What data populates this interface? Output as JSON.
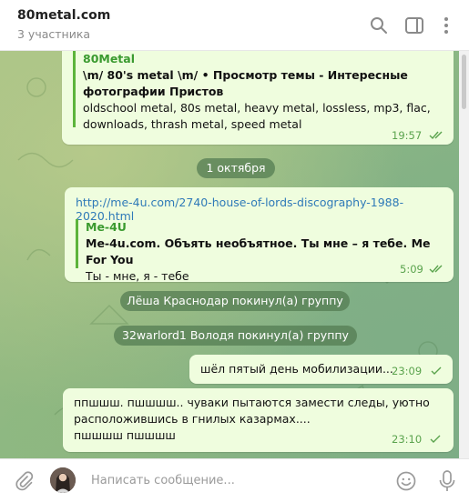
{
  "header": {
    "title": "80metal.com",
    "subtitle": "3 участника",
    "icons": [
      "search-icon",
      "sidebar-toggle-icon",
      "more-vertical-icon"
    ]
  },
  "messages": [
    {
      "type": "outgoing-preview",
      "preview": {
        "site": "80Metal",
        "title": "\\m/ 80's metal \\m/ • Просмотр темы - Интересные фотографии Пристов",
        "description": "oldschool metal, 80s metal, heavy metal, lossless, mp3, flac, downloads, thrash metal, speed metal"
      },
      "time": "19:57"
    },
    {
      "type": "date",
      "text": "1 октября"
    },
    {
      "type": "outgoing-link",
      "link": "http://me-4u.com/2740-house-of-lords-discography-1988-2020.html",
      "preview": {
        "site": "Me-4U",
        "title": "Me-4u.com. Объять необъятное. Ты мне – я тебе. Me For You",
        "description": "Ты - мне, я - тебе"
      },
      "time": "5:09"
    },
    {
      "type": "service",
      "text": "Лёша Краснодар покинул(а) группу"
    },
    {
      "type": "service",
      "text": "32warlord1 Володя покинул(а) группу"
    },
    {
      "type": "outgoing",
      "text": "шёл пятый день мобилизации...",
      "time": "23:09"
    },
    {
      "type": "outgoing",
      "lines": [
        "ппшшш. пшшшш.. чуваки пытаются замести следы, уютно",
        "расположившись в гнилых казармах....",
        "пшшшш пшшшш"
      ],
      "time": "23:10"
    }
  ],
  "input": {
    "placeholder": "Написать сообщение...",
    "icons": [
      "attach-icon",
      "avatar",
      "emoji-icon",
      "microphone-icon"
    ]
  },
  "colors": {
    "outgoing_bubble": "#effdde",
    "accent_green": "#5cb43a",
    "link_blue": "#2f7ab8",
    "service_pill": "#527a50"
  }
}
